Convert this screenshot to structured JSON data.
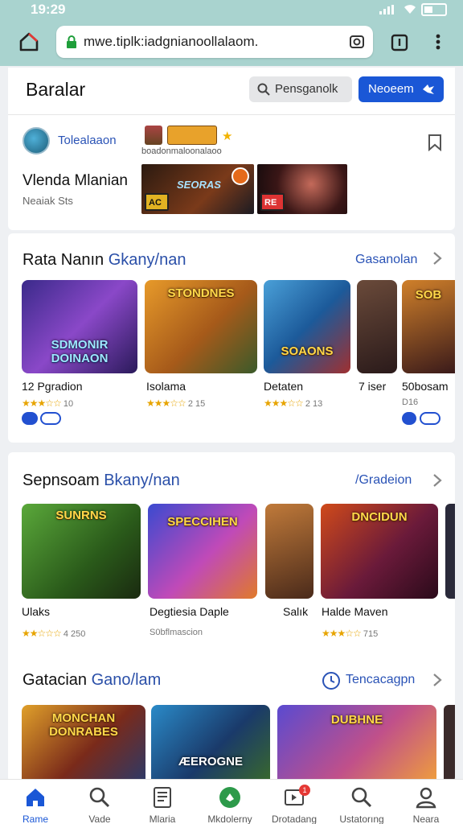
{
  "status": {
    "time": "19:29"
  },
  "browser": {
    "url": "mwe.tiplk:iadgnianoollalaom."
  },
  "header": {
    "brand": "Baralar",
    "search_label": "Pensganolk",
    "cta_label": "Neoeem"
  },
  "promo": {
    "account": "Tolealaaon",
    "title": "Vlenda Mlanian",
    "subtitle": "Neaiak Sts",
    "caption": "boadonmaloonalaoo",
    "shot1_overlay": "SEORAS",
    "shot1_chip": "AC",
    "shot2_chip": "RE"
  },
  "section1": {
    "title_bold": "Rata Nanın",
    "title_light": "Gkany/nan",
    "link": "Gasanolan",
    "items": [
      {
        "name": "12 Pgradion",
        "meta": "10",
        "art": "SDMONIR DOINAON"
      },
      {
        "name": "Isolama",
        "meta": "2 15",
        "art": "STONDNES"
      },
      {
        "name": "Detaten",
        "meta": "2 13",
        "art": "SOAONS"
      },
      {
        "name": "7 iser",
        "meta": "",
        "art": ""
      },
      {
        "name": "50bosam",
        "meta": "D16",
        "art": "SOB"
      }
    ]
  },
  "section2": {
    "title_bold": "Sepnsoam",
    "title_light": "Bkany/nan",
    "link": "/Gradeion",
    "items": [
      {
        "name": "Ulaks",
        "meta": "4 250",
        "art": "SUNRNS"
      },
      {
        "name": "Degtiesia Daple",
        "meta": "S0bflmascion",
        "art": "SPECCIHEN"
      },
      {
        "name": "Salık",
        "meta": "",
        "art": ""
      },
      {
        "name": "Halde Maven",
        "meta": "715",
        "art": "DNCIDUN"
      }
    ]
  },
  "section3": {
    "title_bold": "Gatacian",
    "title_light": "Gano/lam",
    "link": "Tencacagpn",
    "items": [
      {
        "art": "MONCHAN DONRABES"
      },
      {
        "art": "ÆEROGNE"
      },
      {
        "art": "DUBHNE"
      }
    ]
  },
  "nav": [
    {
      "label": "Rame",
      "icon": "home-icon"
    },
    {
      "label": "Vade",
      "icon": "search-icon"
    },
    {
      "label": "Mlaria",
      "icon": "document-icon"
    },
    {
      "label": "Mkdolerny",
      "icon": "game-icon"
    },
    {
      "label": "Drotadang",
      "icon": "inbox-icon",
      "badge": "1"
    },
    {
      "label": "Ustatorıng",
      "icon": "search-icon"
    },
    {
      "label": "Neara",
      "icon": "profile-icon"
    }
  ],
  "colors": {
    "accent": "#1a57d6",
    "browser_bar": "#a9d3cf",
    "star": "#e7a400"
  }
}
